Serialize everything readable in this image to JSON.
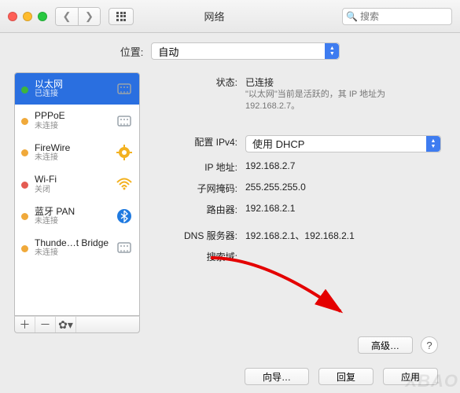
{
  "window": {
    "title": "网络",
    "search_placeholder": "搜索"
  },
  "location": {
    "label": "位置:",
    "value": "自动"
  },
  "services": [
    {
      "name": "以太网",
      "status": "已连接",
      "state": "on",
      "selected": true,
      "icon": "ethernet"
    },
    {
      "name": "PPPoE",
      "status": "未连接",
      "state": "warn",
      "icon": "ethernet"
    },
    {
      "name": "FireWire",
      "status": "未连接",
      "state": "warn",
      "icon": "firewire"
    },
    {
      "name": "Wi-Fi",
      "status": "关闭",
      "state": "off",
      "icon": "wifi"
    },
    {
      "name": "蓝牙 PAN",
      "status": "未连接",
      "state": "warn",
      "icon": "bluetooth"
    },
    {
      "name": "Thunde…t Bridge",
      "status": "未连接",
      "state": "warn",
      "icon": "ethernet"
    }
  ],
  "detail": {
    "status_label": "状态:",
    "status_value": "已连接",
    "status_desc": "\"以太网\"当前是活跃的，其 IP 地址为 192.168.2.7。",
    "config_label": "配置 IPv4:",
    "config_value": "使用 DHCP",
    "ip_label": "IP 地址:",
    "ip_value": "192.168.2.7",
    "mask_label": "子网掩码:",
    "mask_value": "255.255.255.0",
    "router_label": "路由器:",
    "router_value": "192.168.2.1",
    "dns_label": "DNS 服务器:",
    "dns_value": "192.168.2.1、192.168.2.1",
    "search_label": "搜索域:"
  },
  "buttons": {
    "advanced": "高级…",
    "wizard": "向导…",
    "revert": "回复",
    "apply": "应用"
  },
  "watermark": "XBAO"
}
